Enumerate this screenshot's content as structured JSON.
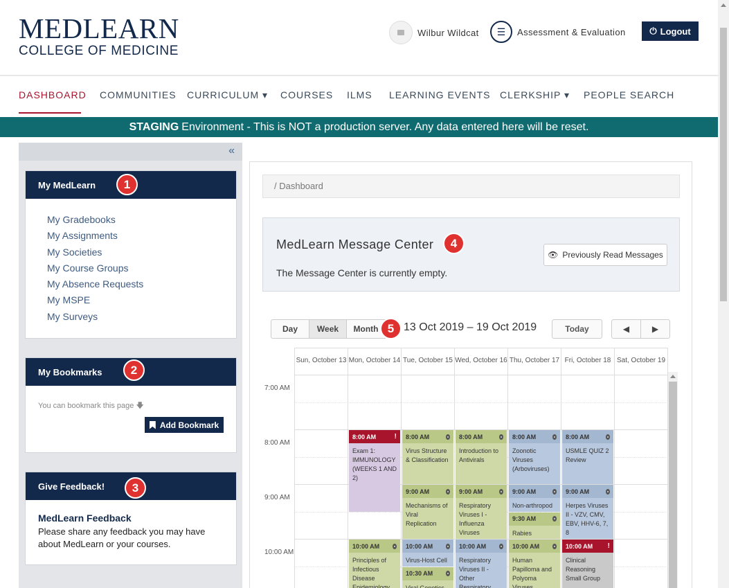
{
  "header": {
    "logo_main": "MEDLEARN",
    "logo_sub": "COLLEGE OF MEDICINE",
    "user_name": "Wilbur Wildcat",
    "assessment_label": "Assessment & Evaluation",
    "logout_label": "Logout"
  },
  "nav": {
    "items": [
      {
        "label": "DASHBOARD"
      },
      {
        "label": "COMMUNITIES"
      },
      {
        "label": "CURRICULUM ▾"
      },
      {
        "label": "COURSES"
      },
      {
        "label": "ILMS"
      },
      {
        "label": "LEARNING EVENTS"
      },
      {
        "label": "CLERKSHIP ▾"
      },
      {
        "label": "PEOPLE SEARCH"
      }
    ]
  },
  "staging": {
    "bold": "STAGING",
    "text": "Environment - This is NOT a production server. Any data entered here will be reset."
  },
  "sidebar": {
    "collapse_icon": "«",
    "my_medlearn": {
      "title": "My MedLearn",
      "badge": "1",
      "links": [
        "My Gradebooks",
        "My Assignments",
        "My Societies",
        "My Course Groups",
        "My Absence Requests",
        "My MSPE",
        "My Surveys"
      ]
    },
    "bookmarks": {
      "title": "My Bookmarks",
      "badge": "2",
      "hint": "You can bookmark this page",
      "hint_icon": "🡇",
      "button": "Add Bookmark"
    },
    "feedback": {
      "title": "Give Feedback!",
      "badge": "3",
      "link": "MedLearn Feedback",
      "text": "Please share any feedback you may have about MedLearn or your courses."
    }
  },
  "main": {
    "breadcrumb": "/  Dashboard",
    "message_center": {
      "title": "MedLearn Message Center",
      "badge": "4",
      "empty_text": "The Message Center is currently empty.",
      "prev_button": "Previously Read Messages"
    },
    "calendar": {
      "views": [
        "Day",
        "Week",
        "Month"
      ],
      "active_view": "Week",
      "badge": "5",
      "date_range": "13 Oct 2019 – 19 Oct 2019",
      "today_button": "Today",
      "prev_icon": "◀",
      "next_icon": "▶",
      "days": [
        "Sun, October 13",
        "Mon, October 14",
        "Tue, October 15",
        "Wed, October 16",
        "Thu, October 17",
        "Fri, October 18",
        "Sat, October 19"
      ],
      "times": [
        "7:00 AM",
        "8:00 AM",
        "9:00 AM",
        "10:00 AM"
      ],
      "events": [
        {
          "day": 1,
          "start": 8.0,
          "end": 9.5,
          "time": "8:00 AM",
          "title": "Exam 1: IMMUNOLOGY (WEEKS 1 AND 2)",
          "style": "purple",
          "marker": "!"
        },
        {
          "day": 2,
          "start": 8.0,
          "end": 9.0,
          "time": "8:00 AM",
          "title": "Virus Structure & Classification",
          "style": "green",
          "marker": "pin"
        },
        {
          "day": 3,
          "start": 8.0,
          "end": 9.0,
          "time": "8:00 AM",
          "title": "Introduction to Antivirals",
          "style": "green",
          "marker": "pin"
        },
        {
          "day": 4,
          "start": 8.0,
          "end": 9.0,
          "time": "8:00 AM",
          "title": "Zoonotic Viruses (Arboviruses)",
          "style": "blue",
          "marker": "pin"
        },
        {
          "day": 5,
          "start": 8.0,
          "end": 9.0,
          "time": "8:00 AM",
          "title": "USMLE QUIZ 2 Review",
          "style": "blue",
          "marker": "pin"
        },
        {
          "day": 2,
          "start": 9.0,
          "end": 10.0,
          "time": "9:00 AM",
          "title": "Mechanisms of Viral Replication",
          "style": "green",
          "marker": "pin"
        },
        {
          "day": 3,
          "start": 9.0,
          "end": 10.0,
          "time": "9:00 AM",
          "title": "Respiratory Viruses I - Influenza Viruses",
          "style": "green",
          "marker": "pin"
        },
        {
          "day": 4,
          "start": 9.0,
          "end": 9.5,
          "time": "9:00 AM",
          "title": "Non-arthropod",
          "style": "blue",
          "marker": "pin"
        },
        {
          "day": 4,
          "start": 9.5,
          "end": 10.0,
          "time": "9:30 AM",
          "title": "Rabies",
          "style": "green",
          "marker": "pin"
        },
        {
          "day": 5,
          "start": 9.0,
          "end": 10.0,
          "time": "9:00 AM",
          "title": "Herpes Viruses II - VZV, CMV, EBV, HHV-6, 7, 8",
          "style": "blue",
          "marker": "pin"
        },
        {
          "day": 1,
          "start": 10.0,
          "end": 11.0,
          "time": "10:00 AM",
          "title": "Principles of Infectious Disease Epidemiology",
          "style": "green",
          "marker": "pin"
        },
        {
          "day": 2,
          "start": 10.0,
          "end": 10.5,
          "time": "10:00 AM",
          "title": "Virus-Host Cell",
          "style": "blue",
          "marker": "pin"
        },
        {
          "day": 2,
          "start": 10.5,
          "end": 11.0,
          "time": "10:30 AM",
          "title": "Viral Genetics",
          "style": "green",
          "marker": "pin"
        },
        {
          "day": 3,
          "start": 10.0,
          "end": 11.0,
          "time": "10:00 AM",
          "title": "Respiratory Viruses II - Other Respiratory",
          "style": "blue",
          "marker": "pin"
        },
        {
          "day": 4,
          "start": 10.0,
          "end": 11.0,
          "time": "10:00 AM",
          "title": "Human Papilloma and Polyoma Viruses",
          "style": "green",
          "marker": "pin"
        },
        {
          "day": 5,
          "start": 10.0,
          "end": 11.0,
          "time": "10:00 AM",
          "title": "Clinical Reasoning Small Group",
          "style": "red",
          "marker": "!"
        }
      ]
    }
  }
}
